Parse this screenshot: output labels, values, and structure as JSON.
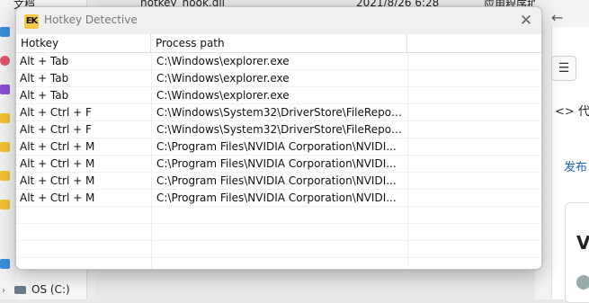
{
  "background": {
    "explorer": {
      "top_labels": [
        "文档",
        "hotkey_hook.dll",
        "2021/8/26 6:28",
        "应用程序扩"
      ],
      "drive_label": "OS (C:)"
    },
    "browser": {
      "code_tab_cjk": "代",
      "publish_text": "发布",
      "card_letter": "V"
    }
  },
  "window": {
    "title": "Hotkey Detective",
    "logo_text": "EK",
    "close_glyph": "✕"
  },
  "list": {
    "columns": [
      "Hotkey",
      "Process path",
      ""
    ],
    "rows": [
      {
        "hotkey": "Alt + Tab",
        "path": "C:\\Windows\\explorer.exe"
      },
      {
        "hotkey": "Alt + Tab",
        "path": "C:\\Windows\\explorer.exe"
      },
      {
        "hotkey": "Alt + Tab",
        "path": "C:\\Windows\\explorer.exe"
      },
      {
        "hotkey": "Alt + Ctrl + F",
        "path": "C:\\Windows\\System32\\DriverStore\\FileRepos..."
      },
      {
        "hotkey": "Alt + Ctrl + F",
        "path": "C:\\Windows\\System32\\DriverStore\\FileRepos..."
      },
      {
        "hotkey": "Alt + Ctrl + M",
        "path": "C:\\Program Files\\NVIDIA Corporation\\NVIDI..."
      },
      {
        "hotkey": "Alt + Ctrl + M",
        "path": "C:\\Program Files\\NVIDIA Corporation\\NVIDI..."
      },
      {
        "hotkey": "Alt + Ctrl + M",
        "path": "C:\\Program Files\\NVIDIA Corporation\\NVIDI..."
      },
      {
        "hotkey": "Alt + Ctrl + M",
        "path": "C:\\Program Files\\NVIDIA Corporation\\NVIDI..."
      }
    ]
  },
  "colors": {
    "logo": "#f7c948",
    "link": "#1a5fb4"
  }
}
